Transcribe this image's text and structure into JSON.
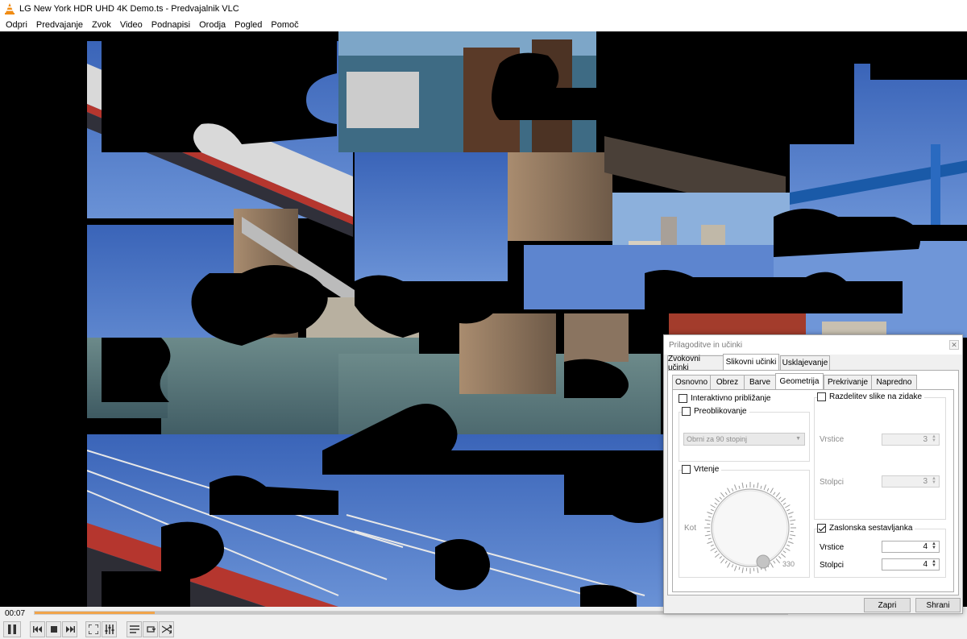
{
  "window": {
    "title": "LG New York HDR UHD 4K Demo.ts - Predvajalnik VLC"
  },
  "menu": [
    "Odpri",
    "Predvajanje",
    "Zvok",
    "Video",
    "Podnapisi",
    "Orodja",
    "Pogled",
    "Pomoč"
  ],
  "playback": {
    "elapsed": "00:07",
    "progress_fraction": 0.16,
    "buffered_fraction": 1.0
  },
  "dialog": {
    "title": "Prilagoditve in učinki",
    "close_glyph": "✕",
    "main_tabs": [
      "Zvokovni učinki",
      "Slikovni učinki",
      "Usklajevanje"
    ],
    "active_main_tab": "Slikovni učinki",
    "sub_tabs": [
      "Osnovno",
      "Obrez",
      "Barve",
      "Geometrija",
      "Prekrivanje",
      "Napredno"
    ],
    "active_sub_tab": "Geometrija",
    "interactive_zoom": {
      "label": "Interaktivno približanje",
      "checked": false
    },
    "transform": {
      "label": "Preoblikovanje",
      "checked": false,
      "combo_value": "Obrni za 90 stopinj"
    },
    "rotate": {
      "label": "Vrtenje",
      "checked": false,
      "angle_label": "Kot",
      "angle_value": "330"
    },
    "wall": {
      "label": "Razdelitev slike na zidake",
      "checked": false,
      "rows_label": "Vrstice",
      "rows_value": "3",
      "cols_label": "Stolpci",
      "cols_value": "3"
    },
    "puzzle": {
      "label": "Zaslonska sestavljanka",
      "checked": true,
      "rows_label": "Vrstice",
      "rows_value": "4",
      "cols_label": "Stolpci",
      "cols_value": "4"
    },
    "buttons": {
      "close": "Zapri",
      "save": "Shrani"
    }
  },
  "controls": {
    "icons": [
      "pause-icon",
      "previous-icon",
      "stop-icon",
      "next-icon",
      "fullscreen-icon",
      "extended-settings-icon",
      "playlist-icon",
      "loop-icon",
      "shuffle-icon"
    ]
  },
  "colors": {
    "vlc_orange": "#f08c14",
    "sky": "#4a78c8",
    "water": "#5a7f8e",
    "seek_fill": "#f0a44a"
  }
}
